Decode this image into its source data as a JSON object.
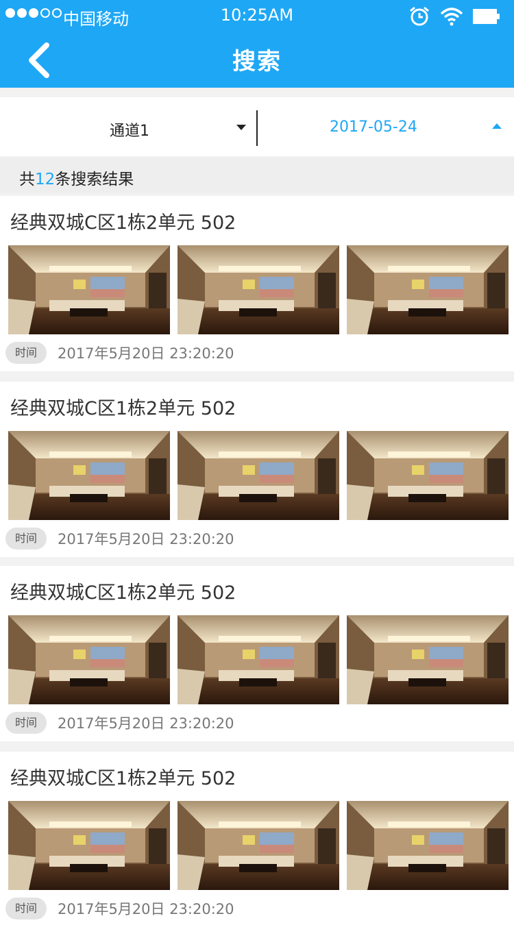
{
  "status_bar": {
    "carrier": "中国移动",
    "time": "10:25AM",
    "signal_filled": 3,
    "signal_total": 5
  },
  "nav": {
    "title": "搜索"
  },
  "filters": {
    "channel": "通道1",
    "date": "2017-05-24"
  },
  "results": {
    "prefix": "共",
    "count": "12",
    "suffix": "条搜索结果",
    "items": [
      {
        "title": "经典双城C区1栋2单元 502",
        "time_label": "时间",
        "time": "2017年5月20日 23:20:20"
      },
      {
        "title": "经典双城C区1栋2单元 502",
        "time_label": "时间",
        "time": "2017年5月20日 23:20:20"
      },
      {
        "title": "经典双城C区1栋2单元 502",
        "time_label": "时间",
        "time": "2017年5月20日 23:20:20"
      },
      {
        "title": "经典双城C区1栋2单元 502",
        "time_label": "时间",
        "time": "2017年5月20日 23:20:20"
      }
    ]
  },
  "colors": {
    "accent": "#1ea7f5",
    "background": "#f2f2f2"
  },
  "icons": [
    "back-arrow-icon",
    "alarm-icon",
    "wifi-icon",
    "battery-icon",
    "dropdown-arrow-icon",
    "room-photo-icon"
  ]
}
